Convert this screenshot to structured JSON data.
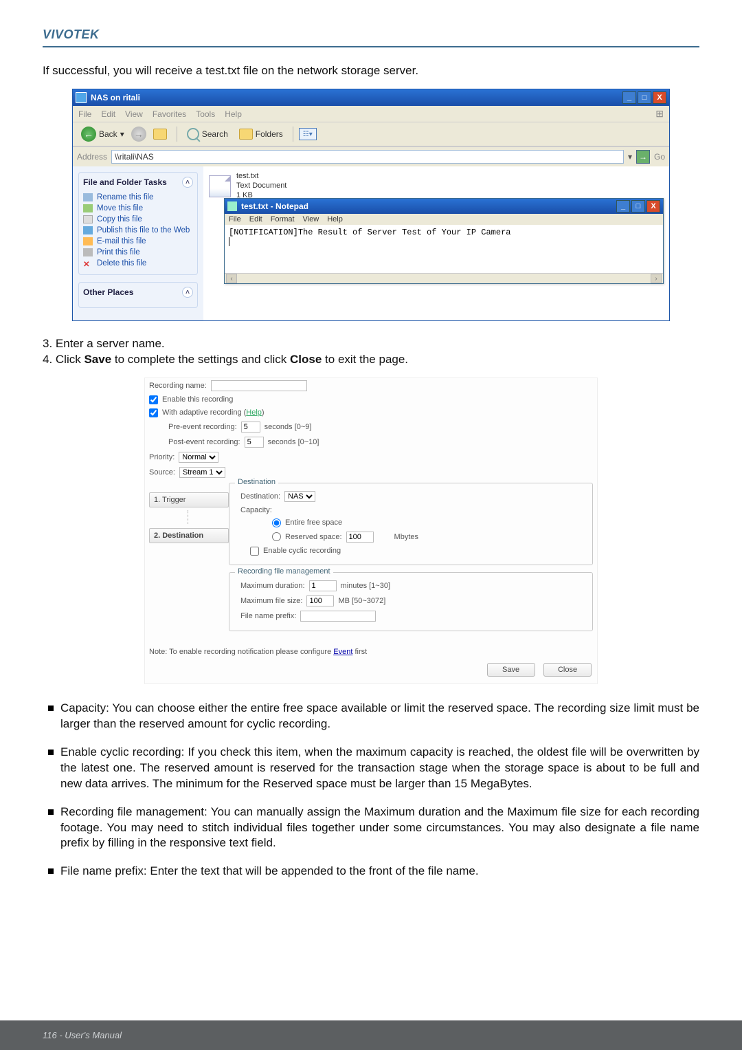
{
  "branding": {
    "name": "VIVOTEK"
  },
  "intro": "If successful, you will receive a test.txt file on the network storage server.",
  "explorer": {
    "title": "NAS on ritali",
    "menu": [
      "File",
      "Edit",
      "View",
      "Favorites",
      "Tools",
      "Help"
    ],
    "toolbar": {
      "back": "Back",
      "search": "Search",
      "folders": "Folders"
    },
    "address_label": "Address",
    "address_value": "\\\\ritali\\NAS",
    "go": "Go",
    "tasks_header": "File and Folder Tasks",
    "tasks": [
      "Rename this file",
      "Move this file",
      "Copy this file",
      "Publish this file to the Web",
      "E-mail this file",
      "Print this file",
      "Delete this file"
    ],
    "other_header": "Other Places",
    "file": {
      "name": "test.txt",
      "type": "Text Document",
      "size": "1 KB"
    },
    "notepad": {
      "title": "test.txt - Notepad",
      "menu": [
        "File",
        "Edit",
        "Format",
        "View",
        "Help"
      ],
      "content": "[NOTIFICATION]The Result of Server Test of Your IP Camera"
    }
  },
  "steps": {
    "s3": "3. Enter a server name.",
    "s4_pre": "4. Click ",
    "s4_save": "Save",
    "s4_mid": " to complete the settings and click ",
    "s4_close": "Close",
    "s4_end": " to exit the page."
  },
  "settings": {
    "recording_name_label": "Recording name:",
    "enable_recording": "Enable this recording",
    "adaptive_label_pre": "With adaptive recording (",
    "adaptive_help": "Help",
    "adaptive_label_post": ")",
    "pre_event_label": "Pre-event recording:",
    "pre_event_value": "5",
    "pre_event_hint": "seconds [0~9]",
    "post_event_label": "Post-event recording:",
    "post_event_value": "5",
    "post_event_hint": "seconds [0~10]",
    "priority_label": "Priority:",
    "priority_value": "Normal",
    "source_label": "Source:",
    "source_value": "Stream 1",
    "step1": "1. Trigger",
    "step2": "2. Destination",
    "dest_legend": "Destination",
    "destination_label": "Destination:",
    "destination_value": "NAS",
    "capacity_label": "Capacity:",
    "entire_free": "Entire free space",
    "reserved_label": "Reserved space:",
    "reserved_value": "100",
    "reserved_unit": "Mbytes",
    "cyclic": "Enable cyclic recording",
    "mgmt_legend": "Recording file management",
    "max_dur_label": "Maximum duration:",
    "max_dur_value": "1",
    "max_dur_hint": "minutes [1~30]",
    "max_size_label": "Maximum file size:",
    "max_size_value": "100",
    "max_size_hint": "MB [50~3072]",
    "prefix_label": "File name prefix:",
    "note_pre": "Note: To enable recording notification please configure ",
    "note_link": "Event",
    "note_post": " first",
    "save_btn": "Save",
    "close_btn": "Close"
  },
  "bullets": {
    "b1": "Capacity: You can choose either the entire free space available or limit the reserved space. The recording size limit must be larger than the reserved amount for cyclic recording.",
    "b2": "Enable cyclic recording: If you check this item, when the maximum capacity is reached, the oldest file will be overwritten by the latest one. The reserved amount is reserved for the transaction stage when the storage space is about to be full and new data arrives. The minimum for the Reserved space must be larger than 15 MegaBytes.",
    "b3": "Recording file management: You can manually assign the Maximum duration and the Maximum file size for each recording footage. You may need to stitch individual files together under some circumstances. You may also designate a file name prefix by filling in the responsive text field.",
    "b4": "File name prefix: Enter the text that will be appended to the front of the file name."
  },
  "footer": "116 - User's Manual"
}
